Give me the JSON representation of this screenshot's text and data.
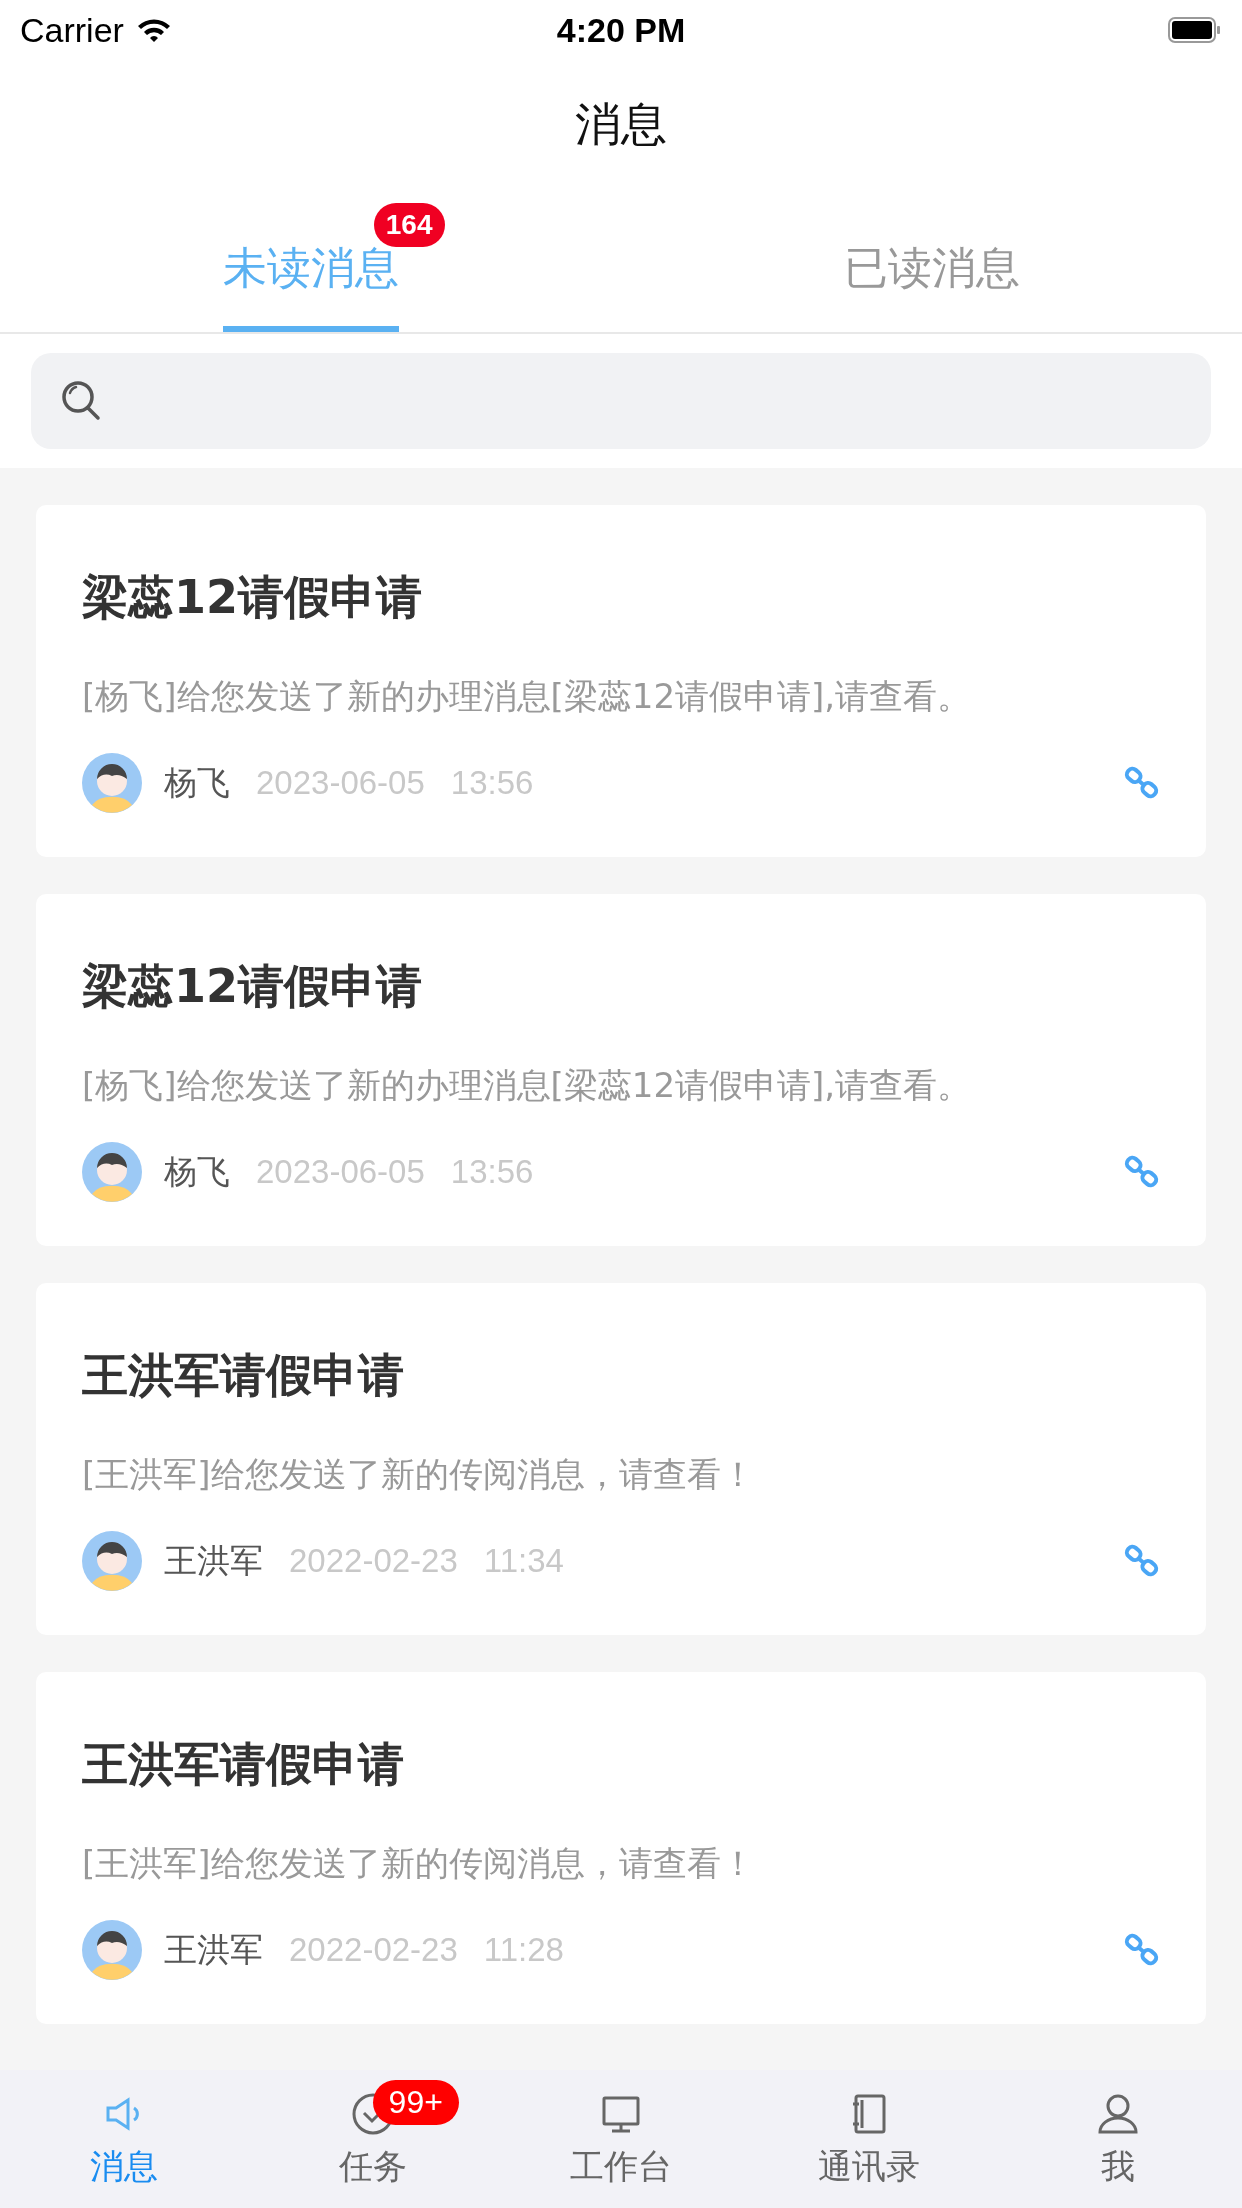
{
  "status_bar": {
    "carrier": "Carrier",
    "time": "4:20 PM"
  },
  "nav": {
    "title": "消息"
  },
  "tabs": [
    {
      "label": "未读消息",
      "selected": true,
      "badge": "164"
    },
    {
      "label": "已读消息",
      "selected": false
    }
  ],
  "messages": [
    {
      "title": "梁蕊12请假申请",
      "summary": "[杨飞]给您发送了新的办理消息[梁蕊12请假申请],请查看。",
      "sender": "杨飞",
      "date": "2023-06-05",
      "time": "13:56"
    },
    {
      "title": "梁蕊12请假申请",
      "summary": "[杨飞]给您发送了新的办理消息[梁蕊12请假申请],请查看。",
      "sender": "杨飞",
      "date": "2023-06-05",
      "time": "13:56"
    },
    {
      "title": "王洪军请假申请",
      "summary": "[王洪军]给您发送了新的传阅消息，请查看！",
      "sender": "王洪军",
      "date": "2022-02-23",
      "time": "11:34"
    },
    {
      "title": "王洪军请假申请",
      "summary": "[王洪军]给您发送了新的传阅消息，请查看！",
      "sender": "王洪军",
      "date": "2022-02-23",
      "time": "11:28"
    }
  ],
  "tab_bar": [
    {
      "kind": "speaker",
      "label": "消息",
      "selected": true
    },
    {
      "kind": "check",
      "label": "任务",
      "selected": false,
      "badge": "99+"
    },
    {
      "kind": "monitor",
      "label": "工作台",
      "selected": false
    },
    {
      "kind": "book",
      "label": "通讯录",
      "selected": false
    },
    {
      "kind": "person",
      "label": "我",
      "selected": false
    }
  ]
}
